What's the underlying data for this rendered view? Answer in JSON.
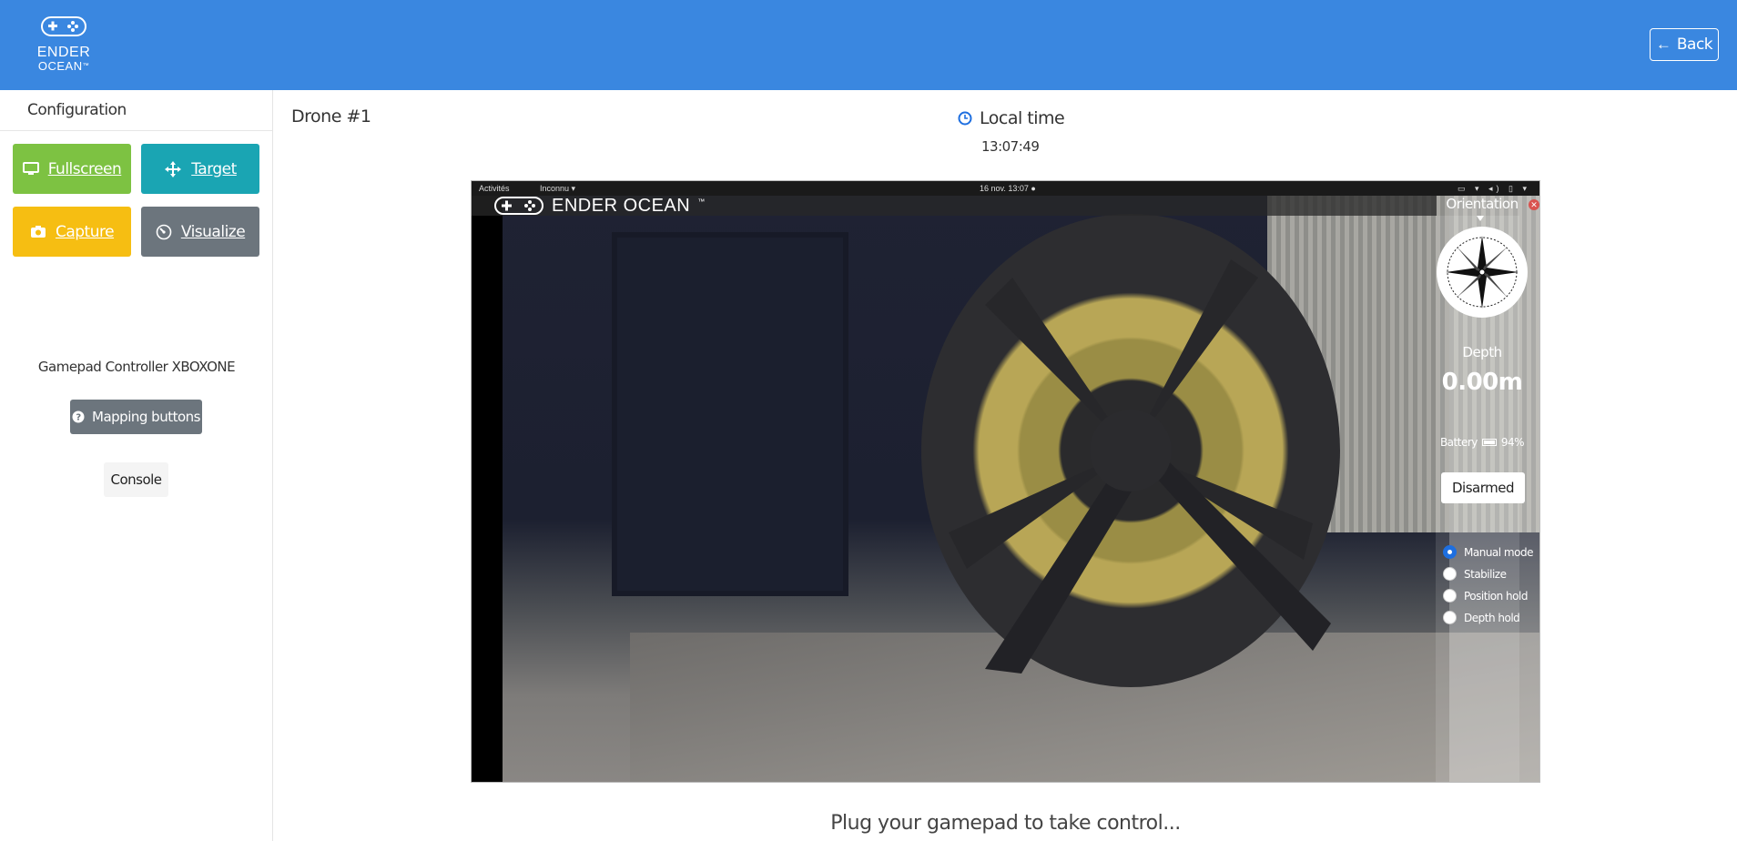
{
  "header": {
    "logo": {
      "line1": "ENDER",
      "line2": "OCEAN",
      "tm": "™",
      "icon": "gamepad-icon"
    },
    "back_label": "Back",
    "colors": {
      "background": "#3a87e0",
      "text": "#ffffff"
    }
  },
  "sidebar": {
    "title": "Configuration",
    "buttons": {
      "fullscreen": {
        "label": "Fullscreen",
        "icon": "monitor-icon",
        "color": "#7dc242"
      },
      "target": {
        "label": "Target",
        "icon": "move-icon",
        "color": "#1aa5b3"
      },
      "capture": {
        "label": "Capture",
        "icon": "camera-icon",
        "color": "#f6be12"
      },
      "visualize": {
        "label": "Visualize",
        "icon": "gauge-icon",
        "color": "#6c757d"
      }
    },
    "gamepad_label": "Gamepad Controller XBOXONE",
    "mapping_label": "Mapping buttons",
    "console_label": "Console"
  },
  "main": {
    "drone_title": "Drone #1",
    "local_time_label": "Local time",
    "local_time_value": "13:07:49",
    "plug_message": "Plug your gamepad to take control..."
  },
  "video": {
    "os_bar": {
      "activities": "Activités",
      "app": "Inconnu ▾",
      "clock": "16 nov.  13:07 ●"
    },
    "brand": "ENDER OCEAN",
    "brand_tm": "™",
    "hud": {
      "orientation_label": "Orientation",
      "depth_label": "Depth",
      "depth_value": "0.00m",
      "battery_label": "Battery",
      "battery_value": "94%",
      "battery_level": 0.94,
      "armed_label": "Disarmed",
      "modes": [
        {
          "label": "Manual mode",
          "selected": true
        },
        {
          "label": "Stabilize",
          "selected": false
        },
        {
          "label": "Position hold",
          "selected": false
        },
        {
          "label": "Depth hold",
          "selected": false
        }
      ]
    }
  }
}
